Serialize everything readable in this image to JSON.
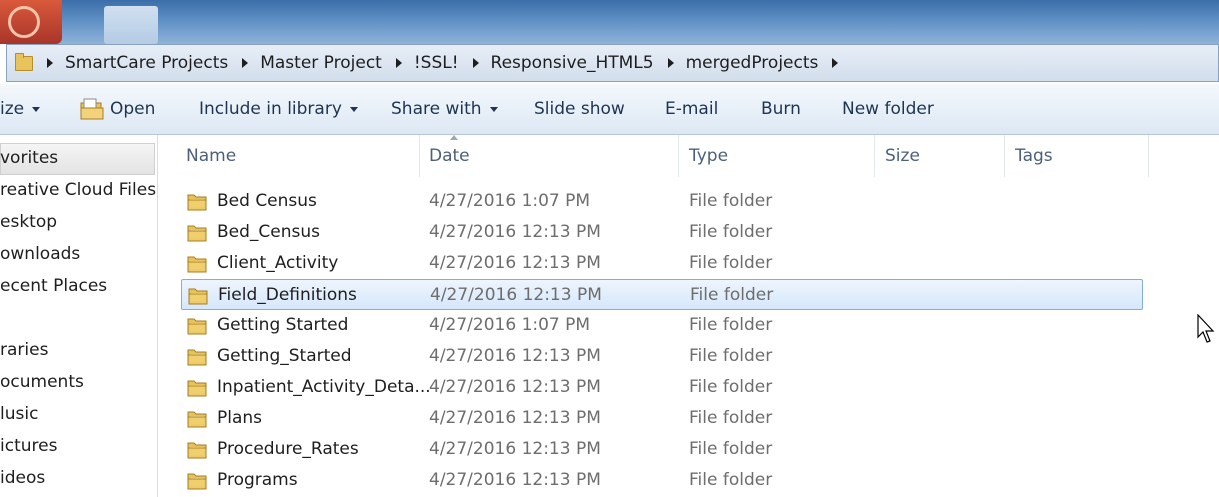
{
  "address_bar": {
    "crumbs": [
      "SmartCare Projects",
      "Master Project",
      "!SSL!",
      "Responsive_HTML5",
      "mergedProjects"
    ]
  },
  "toolbar": {
    "organize": "ize",
    "open": "Open",
    "include_in_library": "Include in library",
    "share_with": "Share with",
    "slide_show": "Slide show",
    "email": "E-mail",
    "burn": "Burn",
    "new_folder": "New folder"
  },
  "nav": {
    "favorites": "vorites",
    "items": [
      "reative Cloud Files",
      "esktop",
      "ownloads",
      "ecent Places"
    ],
    "libraries": "raries",
    "lib_items": [
      "ocuments",
      "lusic",
      "ictures",
      "ideos"
    ]
  },
  "columns": {
    "name": "Name",
    "date": "Date",
    "type": "Type",
    "size": "Size",
    "tags": "Tags"
  },
  "files": [
    {
      "name": "Bed Census",
      "date": "4/27/2016 1:07 PM",
      "type": "File folder"
    },
    {
      "name": "Bed_Census",
      "date": "4/27/2016 12:13 PM",
      "type": "File folder"
    },
    {
      "name": "Client_Activity",
      "date": "4/27/2016 12:13 PM",
      "type": "File folder"
    },
    {
      "name": "Field_Definitions",
      "date": "4/27/2016 12:13 PM",
      "type": "File folder"
    },
    {
      "name": "Getting Started",
      "date": "4/27/2016 1:07 PM",
      "type": "File folder"
    },
    {
      "name": "Getting_Started",
      "date": "4/27/2016 12:13 PM",
      "type": "File folder"
    },
    {
      "name": "Inpatient_Activity_Deta...",
      "date": "4/27/2016 12:13 PM",
      "type": "File folder"
    },
    {
      "name": "Plans",
      "date": "4/27/2016 12:13 PM",
      "type": "File folder"
    },
    {
      "name": "Procedure_Rates",
      "date": "4/27/2016 12:13 PM",
      "type": "File folder"
    },
    {
      "name": "Programs",
      "date": "4/27/2016 12:13 PM",
      "type": "File folder"
    }
  ],
  "selected_file": "Field_Definitions",
  "colors": {
    "selection_fill": "#d6e7fb",
    "selection_border": "#84acdd",
    "folder_yellow": "#e8c25a"
  }
}
